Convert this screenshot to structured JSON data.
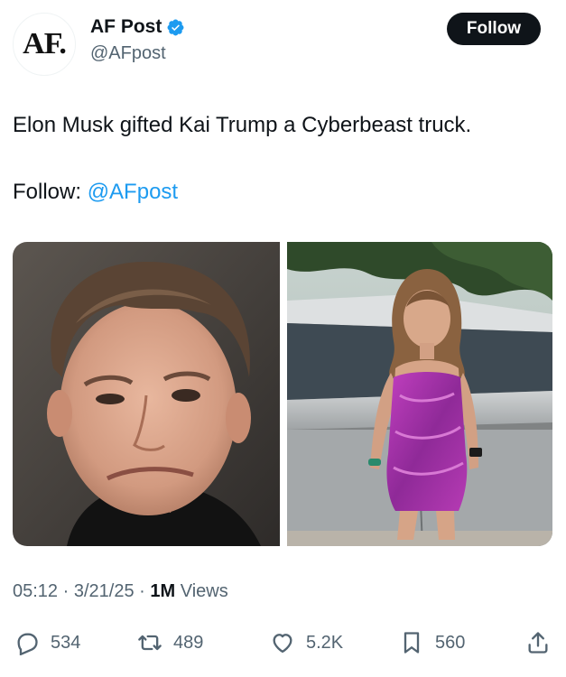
{
  "author": {
    "avatar_text": "AF.",
    "display_name": "AF Post",
    "handle": "@AFpost",
    "verified_icon": "verified-badge-icon",
    "verified_color": "#1d9bf0"
  },
  "follow_button": {
    "label": "Follow"
  },
  "tweet": {
    "text": "Elon Musk gifted Kai Trump a Cyberbeast truck.",
    "follow_prefix": "Follow: ",
    "follow_mention": "@AFpost",
    "mention_color": "#1d9bf0"
  },
  "media": [
    {
      "kind": "photo",
      "subject": "man-portrait"
    },
    {
      "kind": "photo",
      "subject": "woman-with-truck"
    }
  ],
  "meta": {
    "time": "05:12",
    "sep1": " · ",
    "date": "3/21/25",
    "sep2": " · ",
    "views_count": "1M",
    "views_label": " Views"
  },
  "actions": {
    "replies": {
      "icon": "reply-icon",
      "count": "534"
    },
    "reposts": {
      "icon": "repost-icon",
      "count": "489"
    },
    "likes": {
      "icon": "heart-icon",
      "count": "5.2K"
    },
    "bookmarks": {
      "icon": "bookmark-icon",
      "count": "560"
    },
    "share": {
      "icon": "share-icon"
    }
  }
}
